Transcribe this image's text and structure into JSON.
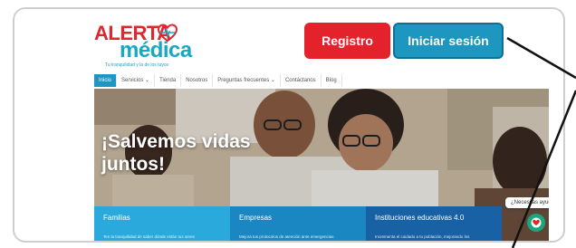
{
  "logo": {
    "top_text": "ALERTA",
    "main_text": "médica",
    "tagline": "Tu tranquilidad y la de los tuyos",
    "brand_red": "#e1262d",
    "brand_cyan": "#1aa7c4"
  },
  "header": {
    "register_label": "Registro",
    "login_label": "Iniciar sesión"
  },
  "nav": {
    "items": [
      {
        "label": "Inicio"
      },
      {
        "label": "Servicios ⌄"
      },
      {
        "label": "Tienda"
      },
      {
        "label": "Nosotros"
      },
      {
        "label": "Preguntas frecuentes ⌄"
      },
      {
        "label": "Contáctanos"
      },
      {
        "label": "Blog"
      }
    ]
  },
  "hero": {
    "title_line1": "¡Salvemos vidas",
    "title_line2": "juntos!"
  },
  "cards": [
    {
      "title": "Familias",
      "desc": "Ten la tranquilidad de saber dónde están tus seres"
    },
    {
      "title": "Empresas",
      "desc": "Mejora tus protocolos de atención ante emergencias"
    },
    {
      "title": "Instituciones educativas 4.0",
      "desc": "Incrementa el cuidado a tu población, mejorando los"
    }
  ],
  "help": {
    "label": "¿Necesitas ayuda?"
  }
}
